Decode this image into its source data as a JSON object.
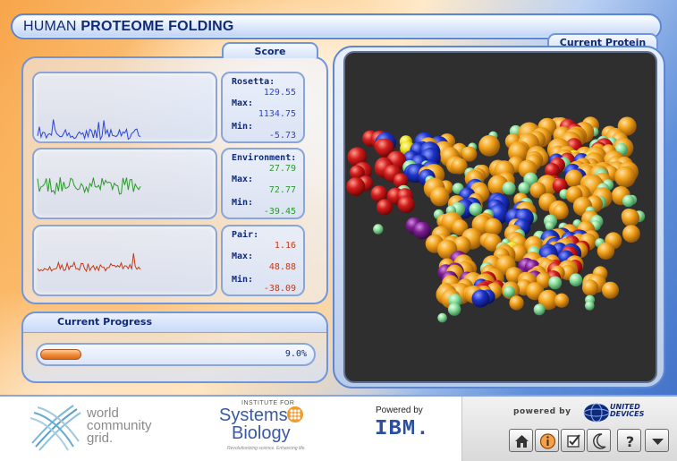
{
  "window": {
    "title_prefix": "HUMAN ",
    "title_bold": "PROTEOME FOLDING"
  },
  "score": {
    "header": "Score",
    "metrics": [
      {
        "label": "Rosetta:",
        "current": "129.55",
        "max_label": "Max:",
        "max": "1134.75",
        "min_label": "Min:",
        "min": "-5.73",
        "color": "#2a46d8"
      },
      {
        "label": "Environment:",
        "current": "27.79",
        "max_label": "Max:",
        "max": "72.77",
        "min_label": "Min:",
        "min": "-39.45",
        "color": "#2a9a2a"
      },
      {
        "label": "Pair:",
        "current": "1.16",
        "max_label": "Max:",
        "max": "48.88",
        "min_label": "Min:",
        "min": "-38.09",
        "color": "#c03a18"
      }
    ]
  },
  "protein": {
    "header": "Current Protein"
  },
  "progress": {
    "header": "Current Progress",
    "percent_text": "9.0%",
    "fraction": 0.09
  },
  "footer": {
    "wcg_line1": "world",
    "wcg_line2": "community",
    "wcg_line3": "grid.",
    "isb_small": "INSTITUTE FOR",
    "isb_line1": "Systems",
    "isb_line2": "Biology",
    "isb_tagline": "Revolutionizing science. Enhancing life.",
    "powered_by": "Powered by",
    "ibm": "IBM.",
    "ud_powered": "powered by",
    "ud_line1": "UNITED",
    "ud_line2": "DEVICES"
  },
  "toolbar": {
    "buttons": [
      {
        "icon": "home-icon"
      },
      {
        "icon": "info-icon"
      },
      {
        "icon": "checkbox-icon"
      },
      {
        "icon": "moon-icon"
      },
      {
        "icon": "help-icon"
      },
      {
        "icon": "dropdown-arrow-icon"
      }
    ]
  },
  "colors": {
    "accent_blue": "#0f2a78",
    "progress_orange": "#f08a35",
    "viewer_bg": "#2f2f2f",
    "atom_red": "#d21c1c",
    "atom_blue": "#1d33c8",
    "atom_orange": "#f2a21a",
    "atom_green": "#8fe0a0",
    "atom_purple": "#7b1d8f",
    "atom_yellow": "#f2e21c"
  }
}
